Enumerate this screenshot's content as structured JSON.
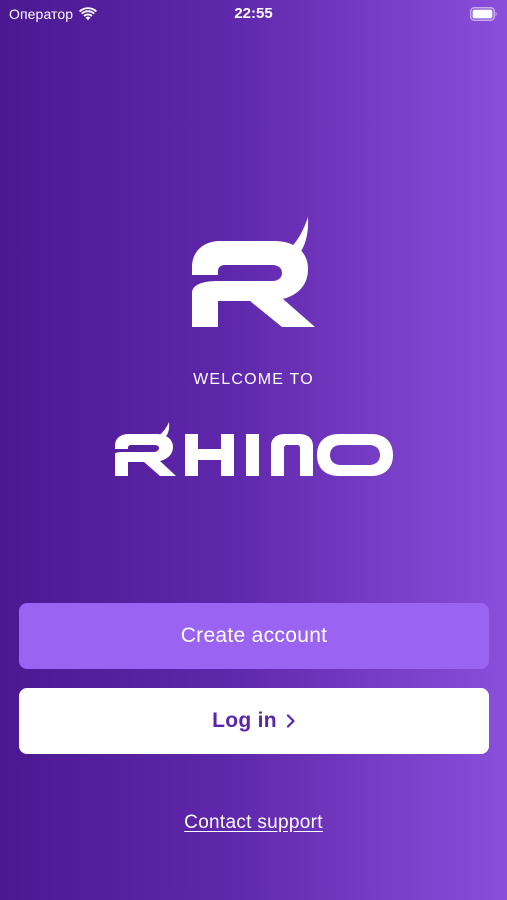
{
  "status_bar": {
    "carrier": "Оператор",
    "time": "22:55",
    "wifi_icon": "wifi-icon",
    "battery_icon": "battery-icon"
  },
  "brand": {
    "welcome": "WELCOME TO",
    "name": "RHINO",
    "logo_icon": "rhino-r-logo-icon"
  },
  "actions": {
    "create_account": "Create account",
    "log_in": "Log in",
    "log_in_icon": "chevron-right-icon",
    "contact_support": "Contact support"
  },
  "colors": {
    "gradient_start": "#4b1891",
    "gradient_end": "#8a4fdb",
    "create_button": "#9a63f2",
    "login_text": "#5a26a8"
  }
}
